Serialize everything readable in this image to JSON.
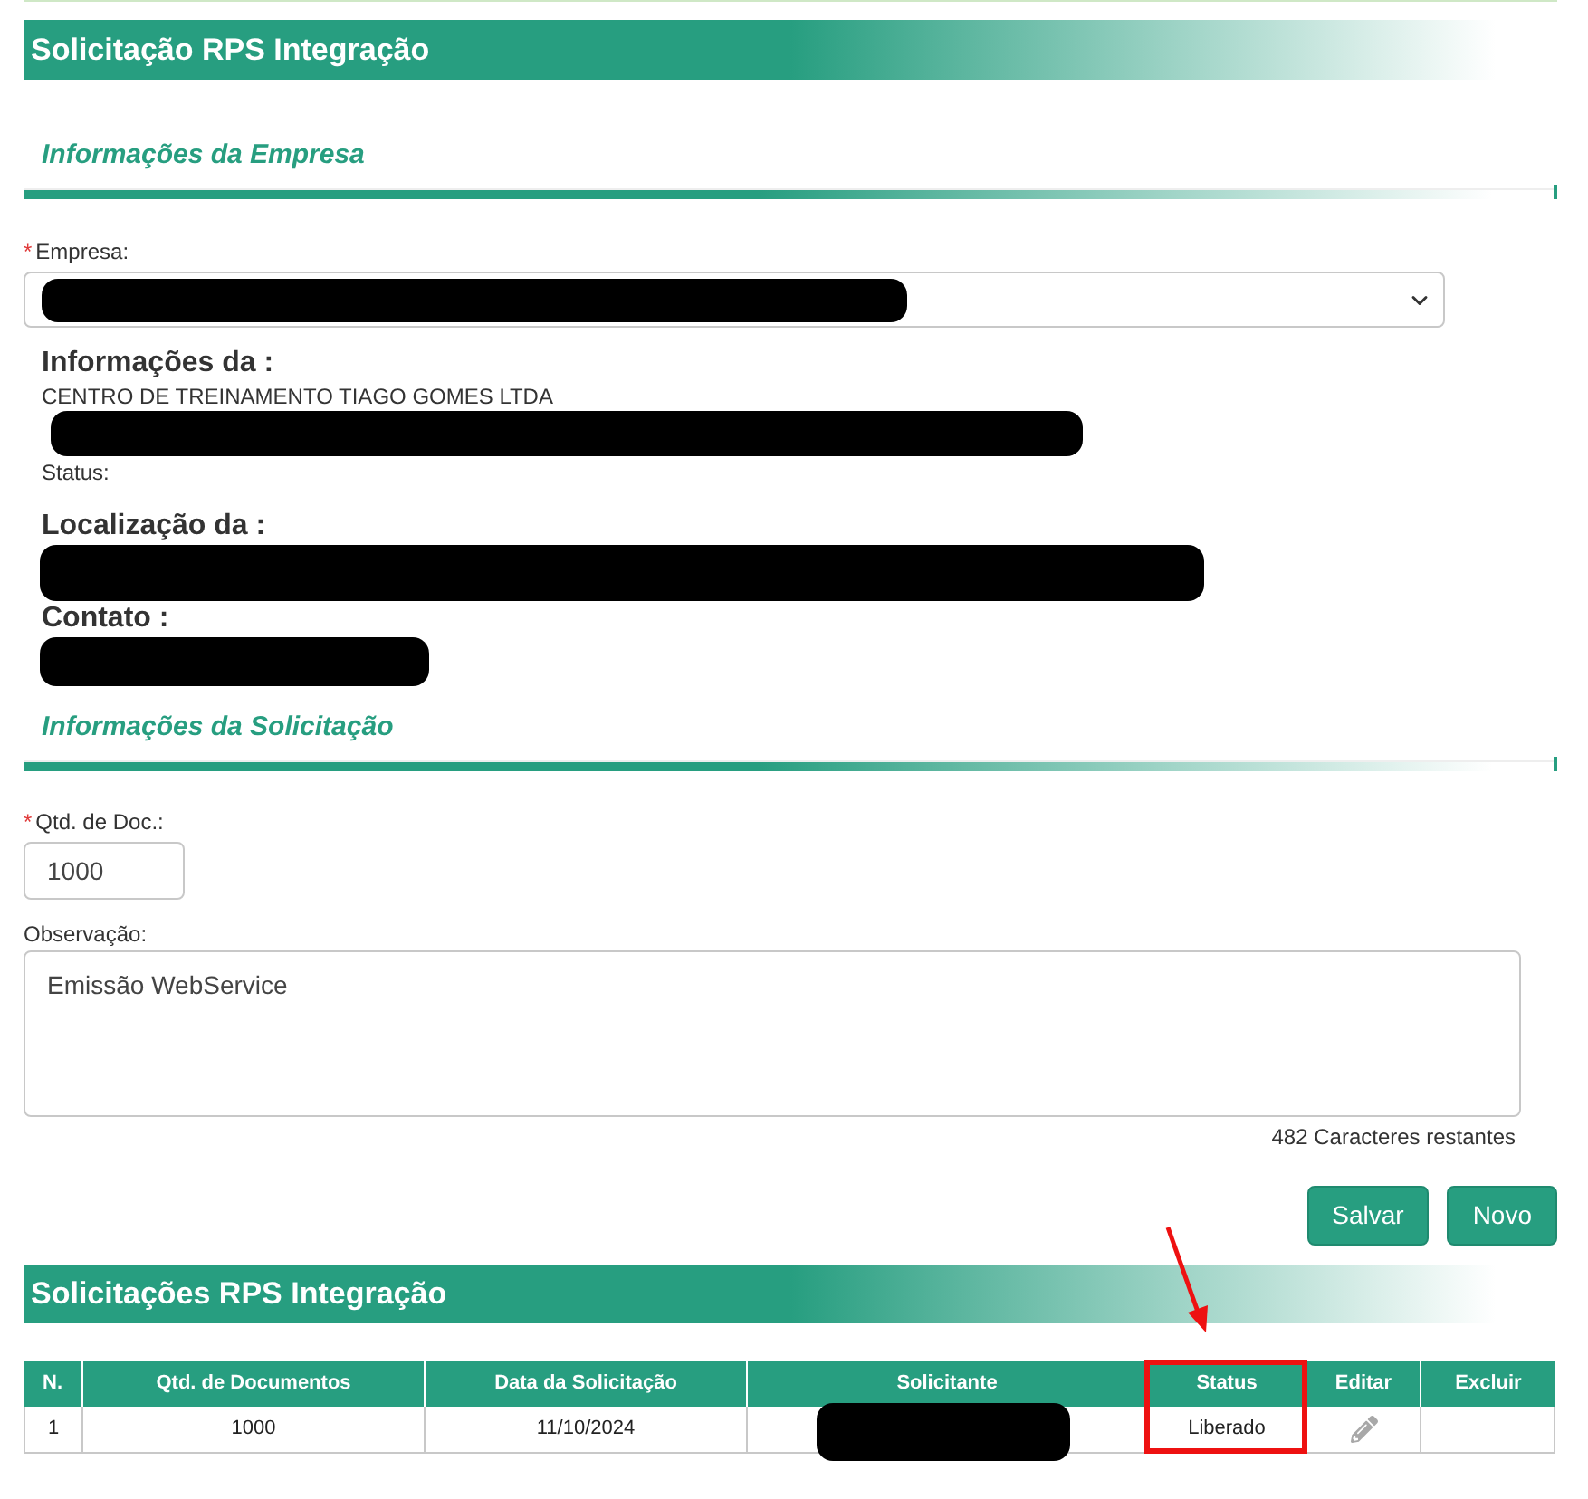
{
  "page_header": {
    "title": "Solicitação RPS Integração"
  },
  "company_section": {
    "title": "Informações da Empresa",
    "company_field": {
      "required_mark": "*",
      "label": "Empresa:",
      "value_redacted": true
    },
    "details": [
      {
        "heading": "Informações da :",
        "lines": [
          {
            "text": "CENTRO DE TREINAMENTO TIAGO GOMES LTDA",
            "redacted": false
          },
          {
            "redacted": true
          },
          {
            "text": "Status:",
            "redacted": false
          }
        ]
      },
      {
        "heading": "Localização da :",
        "lines": [
          {
            "redacted": true
          }
        ]
      },
      {
        "heading": "Contato :",
        "lines": [
          {
            "redacted": true
          }
        ]
      }
    ]
  },
  "request_section": {
    "title": "Informações da Solicitação",
    "doc_count_field": {
      "required_mark": "*",
      "label": "Qtd. de Doc.:",
      "value": "1000"
    },
    "notes_field": {
      "label": "Observação:",
      "value": "Emissão WebService"
    },
    "char_counter": "482 Caracteres restantes",
    "buttons": [
      "Salvar",
      "Novo"
    ]
  },
  "requests_table": {
    "title": "Solicitações RPS Integração",
    "columns": [
      {
        "label": "N.",
        "highlighted": false
      },
      {
        "label": "Qtd. de Documentos",
        "highlighted": false
      },
      {
        "label": "Data da Solicitação",
        "highlighted": false
      },
      {
        "label": "Solicitante",
        "highlighted": false
      },
      {
        "label": "Status",
        "highlighted": true
      },
      {
        "label": "Editar",
        "highlighted": false
      },
      {
        "label": "Excluir",
        "highlighted": false
      }
    ],
    "rows": [
      {
        "cells": [
          {
            "kind": "text",
            "text": "1"
          },
          {
            "kind": "text",
            "text": "1000"
          },
          {
            "kind": "text",
            "text": "11/10/2024"
          },
          {
            "kind": "redacted"
          },
          {
            "kind": "text",
            "text": "Liberado"
          },
          {
            "kind": "edit"
          },
          {
            "kind": "empty"
          }
        ]
      }
    ]
  }
}
